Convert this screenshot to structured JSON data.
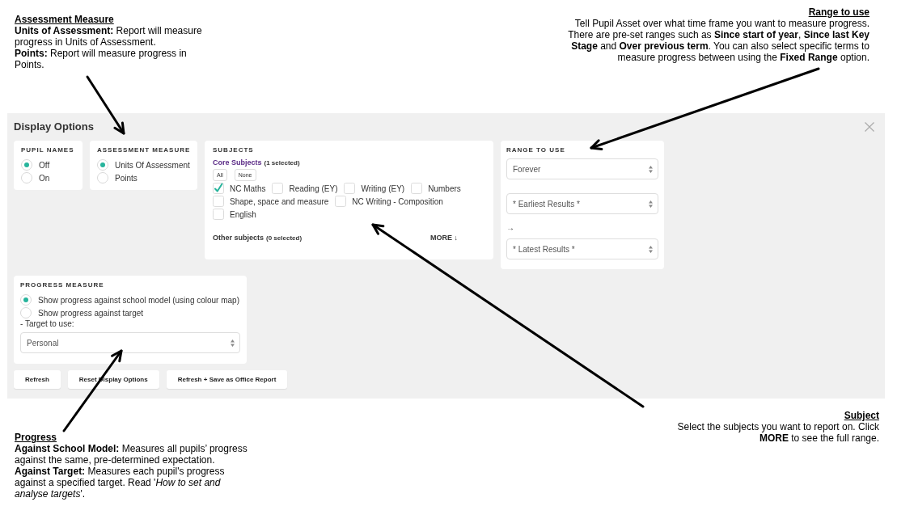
{
  "assessment_note": {
    "title": "Assessment Measure",
    "paragraphs": [
      "**Units of Assessment:** Report will measure progress in Units of Assessment.",
      "**Points:** Report will measure progress in Points."
    ]
  },
  "range_note": {
    "title": "Range to use",
    "paragraphs": [
      "Tell Pupil Asset over what time frame you want to measure progress. There are pre-set ranges such as **Since start of year**, **Since last Key Stage** and **Over previous term**. You can also select specific terms to measure progress between using the **Fixed Range** option."
    ]
  },
  "display_options": {
    "title": "Display Options",
    "pupil_names": {
      "heading": "PUPIL NAMES",
      "options": [
        {
          "label": "Off",
          "selected": true
        },
        {
          "label": "On",
          "selected": false
        }
      ]
    },
    "assessment_measure": {
      "heading": "ASSESSMENT MEASURE",
      "options": [
        {
          "label": "Units Of Assessment",
          "selected": true
        },
        {
          "label": "Points",
          "selected": false
        }
      ]
    },
    "subjects": {
      "heading": "SUBJECTS",
      "core": {
        "label": "Core Subjects",
        "count": "(1 selected)"
      },
      "quick_buttons": [
        "All",
        "None"
      ],
      "items": [
        {
          "label": "NC Maths",
          "checked": true
        },
        {
          "label": "Reading (EY)",
          "checked": false
        },
        {
          "label": "Writing (EY)",
          "checked": false
        },
        {
          "label": "Numbers",
          "checked": false
        },
        {
          "label": "Shape, space and measure",
          "checked": false
        },
        {
          "label": "NC Writing - Composition",
          "checked": false
        },
        {
          "label": "English",
          "checked": false
        }
      ],
      "other": {
        "label": "Other subjects",
        "count": "(0 selected)"
      },
      "more": "MORE ↓"
    },
    "range": {
      "heading": "RANGE TO USE",
      "preset": "Forever",
      "from": "* Earliest Results *",
      "separator": "→",
      "to": "* Latest Results *"
    },
    "progress_measure": {
      "heading": "PROGRESS MEASURE",
      "options": [
        {
          "label": "Show progress against school model (using colour map)",
          "selected": true
        },
        {
          "label": "Show progress against target",
          "selected": false
        }
      ],
      "target_label": "- Target to use:",
      "target": "Personal"
    },
    "buttons": [
      "Refresh",
      "Reset Display Options",
      "Refresh + Save as Office Report"
    ]
  },
  "progress_note": {
    "title": "Progress",
    "paragraphs": [
      "**Against School Model:** Measures all pupils’ progress against the same, pre-determined expectation.",
      "**Against Target:** Measures each pupil's progress against a specified target. Read '*How to set and analyse targets*'."
    ]
  },
  "subject_note": {
    "title": "Subject",
    "paragraphs": [
      "Select the subjects you want to report on. Click **MORE** to see the full range."
    ]
  }
}
